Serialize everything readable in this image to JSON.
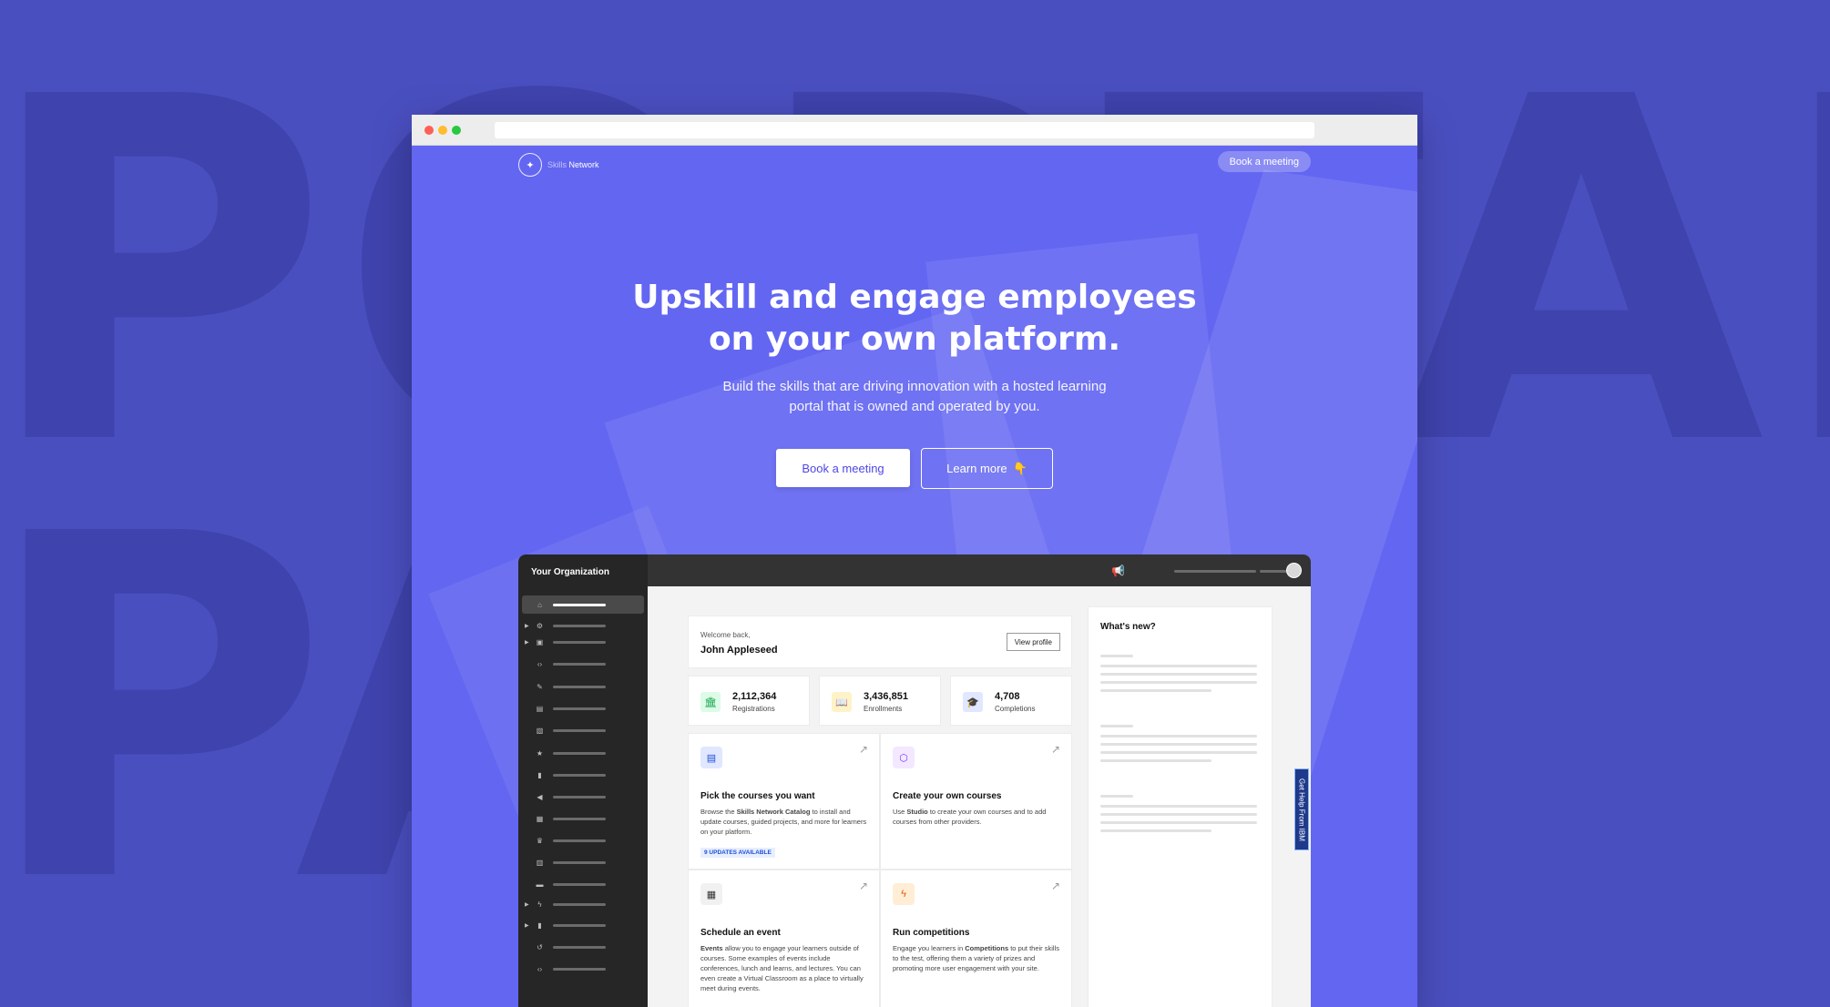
{
  "background_words": [
    "PORTAL",
    "PAGE"
  ],
  "colors": {
    "page_bg": "#4a4fc0",
    "hero_bg": "#6366f1",
    "sidebar_bg": "#262626",
    "accent_blue": "#1d4ed8"
  },
  "nav": {
    "logo_prefix": "Skills",
    "logo_suffix": "Network",
    "cta": "Book a meeting"
  },
  "hero": {
    "title_line1": "Upskill and engage employees",
    "title_line2": "on your own platform.",
    "subtitle_line1": "Build the skills that are driving innovation with a hosted learning",
    "subtitle_line2": "portal that is owned and operated by you.",
    "primary_button": "Book a meeting",
    "secondary_button": "Learn more",
    "secondary_button_emoji": "👇"
  },
  "dashboard": {
    "org_name": "Your Organization",
    "sidebar_icons": [
      "home-icon",
      "gear-icon",
      "storefront-icon",
      "code-icon",
      "brush-icon",
      "list-icon",
      "image-icon",
      "star-icon",
      "document-icon",
      "megaphone-icon",
      "calendar-icon",
      "trophy-icon",
      "archive-icon",
      "ticket-icon",
      "bolt-icon",
      "document-icon",
      "history-icon",
      "code-icon"
    ],
    "welcome": {
      "greeting": "Welcome back,",
      "name": "John Appleseed",
      "button": "View profile"
    },
    "stats": [
      {
        "value": "2,112,364",
        "label": "Registrations",
        "icon": "building-icon"
      },
      {
        "value": "3,436,851",
        "label": "Enrollments",
        "icon": "book-icon"
      },
      {
        "value": "4,708",
        "label": "Completions",
        "icon": "graduation-cap-icon"
      }
    ],
    "features": [
      {
        "title": "Pick the courses you want",
        "desc_pre": "Browse the ",
        "desc_bold": "Skills Network Catalog",
        "desc_post": " to install and update courses, guided projects, and more for learners on your platform.",
        "badge": "9 UPDATES AVAILABLE",
        "icon": "catalog-icon"
      },
      {
        "title": "Create your own courses",
        "desc_pre": "Use ",
        "desc_bold": "Studio",
        "desc_post": " to create your own courses and to add courses from other providers.",
        "icon": "cube-icon"
      },
      {
        "title": "Schedule an event",
        "desc_pre": "",
        "desc_bold": "Events",
        "desc_post": " allow you to engage your learners outside of courses. Some examples of events include conferences, lunch and learns, and lectures. You can even create a Virtual Classroom as a place to virtually meet during events.",
        "icon": "calendar-icon"
      },
      {
        "title": "Run competitions",
        "desc_pre": "Engage you learners in ",
        "desc_bold": "Competitions",
        "desc_post": " to put their skills to the test, offering them a variety of prizes and promoting more user engagement with your site.",
        "icon": "bolt-icon"
      }
    ],
    "whats_new_title": "What's new?",
    "help_tab": "Get Help From IBM"
  }
}
